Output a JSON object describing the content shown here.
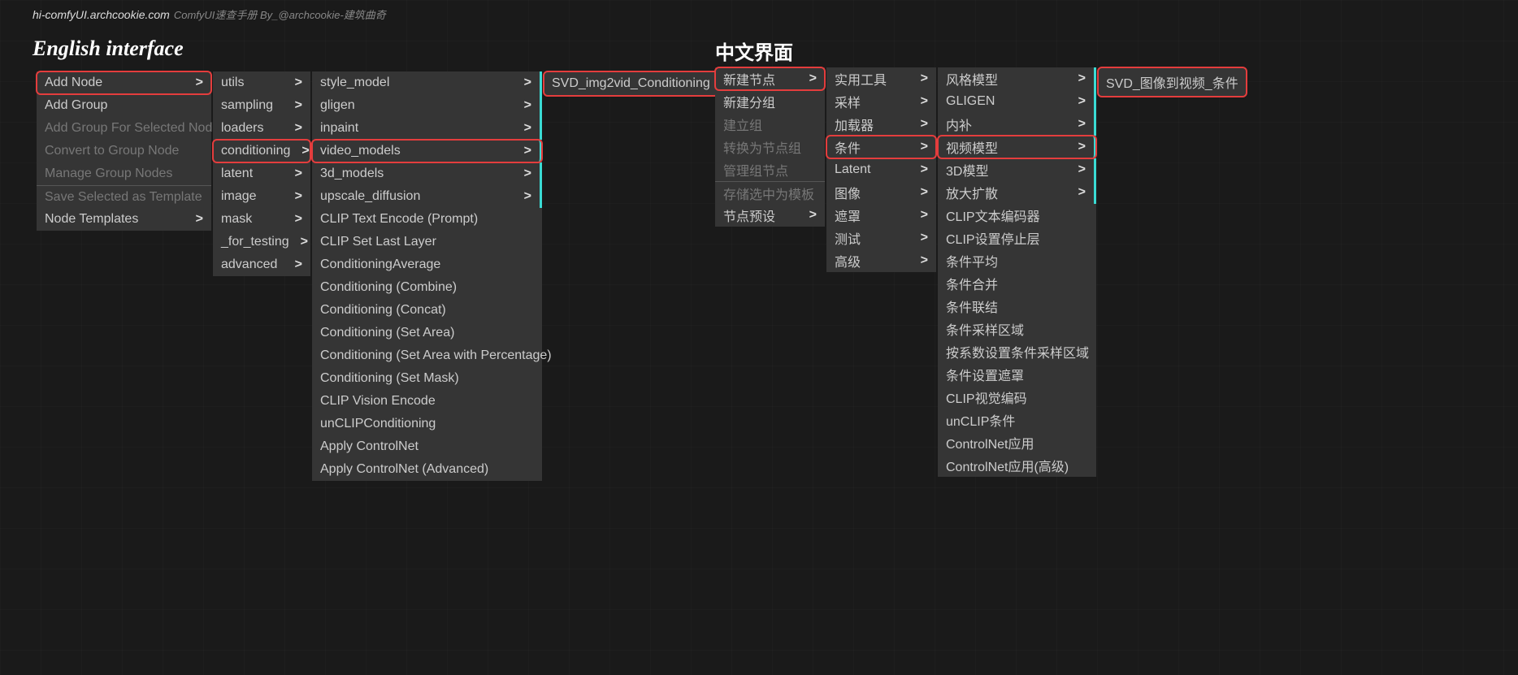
{
  "header": {
    "url": "hi-comfyUI.archcookie.com",
    "desc": "ComfyUI速查手册 By_@archcookie-建筑曲奇"
  },
  "titles": {
    "en": "English interface",
    "cn": "中文界面"
  },
  "en": {
    "c1": [
      {
        "label": "Add Node",
        "hl": true,
        "arrow": true
      },
      {
        "label": "Add Group"
      },
      {
        "label": "Add Group For Selected Nodes",
        "dim": true
      },
      {
        "label": "Convert to Group Node",
        "dim": true
      },
      {
        "label": "Manage Group Nodes",
        "dim": true
      },
      {
        "label": "Save Selected as Template",
        "dim": true,
        "sep": true
      },
      {
        "label": "Node Templates",
        "arrow": true
      }
    ],
    "c2": [
      {
        "label": "utils",
        "arrow": true
      },
      {
        "label": "sampling",
        "arrow": true
      },
      {
        "label": "loaders",
        "arrow": true
      },
      {
        "label": "conditioning",
        "arrow": true,
        "hl": true
      },
      {
        "label": "latent",
        "arrow": true
      },
      {
        "label": "image",
        "arrow": true
      },
      {
        "label": "mask",
        "arrow": true
      },
      {
        "label": "_for_testing",
        "arrow": true
      },
      {
        "label": "advanced",
        "arrow": true
      }
    ],
    "c3": [
      {
        "label": "style_model",
        "arrow": true,
        "bar": true
      },
      {
        "label": "gligen",
        "arrow": true,
        "bar": true
      },
      {
        "label": "inpaint",
        "arrow": true,
        "bar": true
      },
      {
        "label": "video_models",
        "arrow": true,
        "hl": true,
        "bar": true
      },
      {
        "label": "3d_models",
        "arrow": true,
        "bar": true
      },
      {
        "label": "upscale_diffusion",
        "arrow": true,
        "bar": true
      },
      {
        "label": "CLIP Text Encode (Prompt)"
      },
      {
        "label": "CLIP Set Last Layer"
      },
      {
        "label": "ConditioningAverage"
      },
      {
        "label": "Conditioning (Combine)"
      },
      {
        "label": "Conditioning (Concat)"
      },
      {
        "label": "Conditioning (Set Area)"
      },
      {
        "label": "Conditioning (Set Area with Percentage)"
      },
      {
        "label": "Conditioning (Set Mask)"
      },
      {
        "label": "CLIP Vision Encode"
      },
      {
        "label": "unCLIPConditioning"
      },
      {
        "label": "Apply ControlNet"
      },
      {
        "label": "Apply ControlNet (Advanced)"
      }
    ],
    "leaf": "SVD_img2vid_Conditioning"
  },
  "cn": {
    "c1": [
      {
        "label": "新建节点",
        "hl": true,
        "arrow": true
      },
      {
        "label": "新建分组"
      },
      {
        "label": "建立组",
        "dim": true
      },
      {
        "label": "转换为节点组",
        "dim": true
      },
      {
        "label": "管理组节点",
        "dim": true
      },
      {
        "label": "存储选中为模板",
        "dim": true,
        "sep": true
      },
      {
        "label": "节点预设",
        "arrow": true
      }
    ],
    "c2": [
      {
        "label": "实用工具",
        "arrow": true
      },
      {
        "label": "采样",
        "arrow": true
      },
      {
        "label": "加载器",
        "arrow": true
      },
      {
        "label": "条件",
        "arrow": true,
        "hl": true
      },
      {
        "label": "Latent",
        "arrow": true
      },
      {
        "label": "图像",
        "arrow": true
      },
      {
        "label": "遮罩",
        "arrow": true
      },
      {
        "label": "测试",
        "arrow": true
      },
      {
        "label": "高级",
        "arrow": true
      }
    ],
    "c3": [
      {
        "label": "风格模型",
        "arrow": true,
        "bar": true
      },
      {
        "label": "GLIGEN",
        "arrow": true,
        "bar": true
      },
      {
        "label": "内补",
        "arrow": true,
        "bar": true
      },
      {
        "label": "视频模型",
        "arrow": true,
        "hl": true,
        "bar": true
      },
      {
        "label": "3D模型",
        "arrow": true,
        "bar": true
      },
      {
        "label": "放大扩散",
        "arrow": true,
        "bar": true
      },
      {
        "label": "CLIP文本编码器"
      },
      {
        "label": "CLIP设置停止层"
      },
      {
        "label": "条件平均"
      },
      {
        "label": "条件合并"
      },
      {
        "label": "条件联结"
      },
      {
        "label": "条件采样区域"
      },
      {
        "label": "按系数设置条件采样区域"
      },
      {
        "label": "条件设置遮罩"
      },
      {
        "label": "CLIP视觉编码"
      },
      {
        "label": "unCLIP条件"
      },
      {
        "label": "ControlNet应用"
      },
      {
        "label": "ControlNet应用(高级)"
      }
    ],
    "leaf": "SVD_图像到视频_条件"
  }
}
